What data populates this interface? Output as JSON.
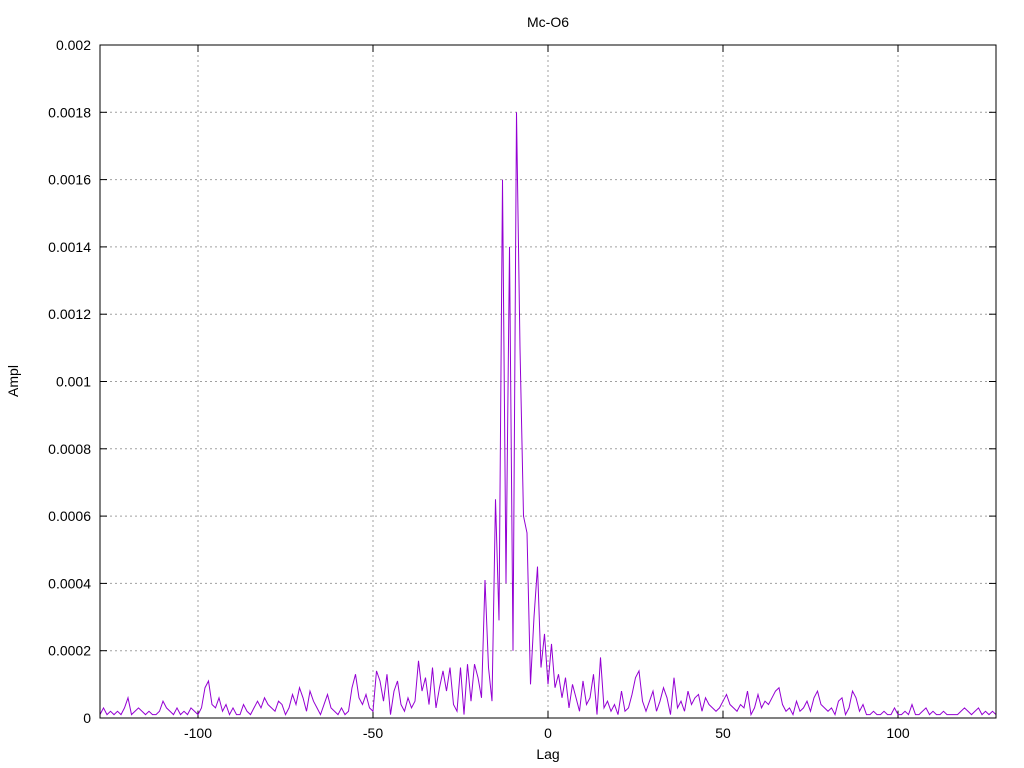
{
  "chart_data": {
    "type": "line",
    "title": "Mc-O6",
    "xlabel": "Lag",
    "ylabel": "Ampl",
    "xlim": [
      -128,
      128
    ],
    "ylim": [
      0,
      0.002
    ],
    "x_ticks": [
      -100,
      -50,
      0,
      50,
      100
    ],
    "x_tick_labels": [
      "-100",
      "-50",
      "0",
      "50",
      "100"
    ],
    "y_ticks": [
      0,
      0.0002,
      0.0004,
      0.0006,
      0.0008,
      0.001,
      0.0012,
      0.0014,
      0.0016,
      0.0018,
      0.002
    ],
    "y_tick_labels": [
      "0",
      "0.0002",
      "0.0004",
      "0.0006",
      "0.0008",
      "0.001",
      "0.0012",
      "0.0014",
      "0.0016",
      "0.0018",
      "0.002"
    ],
    "grid": true,
    "line_color": "#9400D3",
    "series": [
      {
        "x": [
          -128,
          -127,
          -126,
          -125,
          -124,
          -123,
          -122,
          -121,
          -120,
          -119,
          -118,
          -117,
          -116,
          -115,
          -114,
          -113,
          -112,
          -111,
          -110,
          -109,
          -108,
          -107,
          -106,
          -105,
          -104,
          -103,
          -102,
          -101,
          -100,
          -99,
          -98,
          -97,
          -96,
          -95,
          -94,
          -93,
          -92,
          -91,
          -90,
          -89,
          -88,
          -87,
          -86,
          -85,
          -84,
          -83,
          -82,
          -81,
          -80,
          -79,
          -78,
          -77,
          -76,
          -75,
          -74,
          -73,
          -72,
          -71,
          -70,
          -69,
          -68,
          -67,
          -66,
          -65,
          -64,
          -63,
          -62,
          -61,
          -60,
          -59,
          -58,
          -57,
          -56,
          -55,
          -54,
          -53,
          -52,
          -51,
          -50,
          -49,
          -48,
          -47,
          -46,
          -45,
          -44,
          -43,
          -42,
          -41,
          -40,
          -39,
          -38,
          -37,
          -36,
          -35,
          -34,
          -33,
          -32,
          -31,
          -30,
          -29,
          -28,
          -27,
          -26,
          -25,
          -24,
          -23,
          -22,
          -21,
          -20,
          -19,
          -18,
          -17,
          -16,
          -15,
          -14,
          -13,
          -12,
          -11,
          -10,
          -9,
          -8,
          -7,
          -6,
          -5,
          -4,
          -3,
          -2,
          -1,
          0,
          1,
          2,
          3,
          4,
          5,
          6,
          7,
          8,
          9,
          10,
          11,
          12,
          13,
          14,
          15,
          16,
          17,
          18,
          19,
          20,
          21,
          22,
          23,
          24,
          25,
          26,
          27,
          28,
          29,
          30,
          31,
          32,
          33,
          34,
          35,
          36,
          37,
          38,
          39,
          40,
          41,
          42,
          43,
          44,
          45,
          46,
          47,
          48,
          49,
          50,
          51,
          52,
          53,
          54,
          55,
          56,
          57,
          58,
          59,
          60,
          61,
          62,
          63,
          64,
          65,
          66,
          67,
          68,
          69,
          70,
          71,
          72,
          73,
          74,
          75,
          76,
          77,
          78,
          79,
          80,
          81,
          82,
          83,
          84,
          85,
          86,
          87,
          88,
          89,
          90,
          91,
          92,
          93,
          94,
          95,
          96,
          97,
          98,
          99,
          100,
          101,
          102,
          103,
          104,
          105,
          106,
          107,
          108,
          109,
          110,
          111,
          112,
          113,
          114,
          115,
          116,
          117,
          118,
          119,
          120,
          121,
          122,
          123,
          124,
          125,
          126,
          127,
          128
        ],
        "y": [
          1e-05,
          3e-05,
          1e-05,
          2e-05,
          1e-05,
          2e-05,
          1e-05,
          3e-05,
          6e-05,
          1e-05,
          2e-05,
          3e-05,
          2e-05,
          1e-05,
          2e-05,
          1e-05,
          1e-05,
          2e-05,
          5e-05,
          3e-05,
          2e-05,
          1e-05,
          3e-05,
          1e-05,
          2e-05,
          1e-05,
          3e-05,
          2e-05,
          1e-05,
          3e-05,
          9e-05,
          0.00011,
          4e-05,
          3e-05,
          6e-05,
          2e-05,
          4e-05,
          1e-05,
          3e-05,
          1e-05,
          1e-05,
          4e-05,
          2e-05,
          1e-05,
          3e-05,
          5e-05,
          3e-05,
          6e-05,
          4e-05,
          3e-05,
          2e-05,
          5e-05,
          4e-05,
          1e-05,
          3e-05,
          7e-05,
          4e-05,
          9e-05,
          6e-05,
          2e-05,
          8e-05,
          5e-05,
          3e-05,
          1e-05,
          4e-05,
          7e-05,
          3e-05,
          2e-05,
          1e-05,
          3e-05,
          1e-05,
          2e-05,
          9e-05,
          0.00013,
          6e-05,
          4e-05,
          7e-05,
          3e-05,
          2e-05,
          0.00014,
          0.00011,
          5e-05,
          0.00013,
          1e-05,
          8e-05,
          0.00011,
          4e-05,
          2e-05,
          6e-05,
          3e-05,
          5e-05,
          0.00017,
          8e-05,
          0.00012,
          4e-05,
          0.00015,
          3e-05,
          9e-05,
          0.00014,
          8e-05,
          0.00015,
          4e-05,
          2e-05,
          0.00015,
          1e-05,
          0.00016,
          5e-05,
          0.00016,
          0.00012,
          6e-05,
          0.00041,
          0.00015,
          5e-05,
          0.00065,
          0.00029,
          0.0016,
          0.0004,
          0.0014,
          0.0002,
          0.0018,
          0.0011,
          0.0006,
          0.00055,
          0.0001,
          0.0003,
          0.00045,
          0.00015,
          0.00025,
          0.0001,
          0.00022,
          9e-05,
          0.00013,
          6e-05,
          0.00012,
          3e-05,
          0.0001,
          6e-05,
          2e-05,
          0.00011,
          4e-05,
          6e-05,
          0.00013,
          1e-05,
          0.00018,
          3e-05,
          5e-05,
          2e-05,
          4e-05,
          1e-05,
          8e-05,
          2e-05,
          3e-05,
          7e-05,
          0.00012,
          0.00014,
          5e-05,
          2e-05,
          5e-05,
          8e-05,
          2e-05,
          5e-05,
          9e-05,
          6e-05,
          1e-05,
          0.00012,
          3e-05,
          5e-05,
          2e-05,
          8e-05,
          4e-05,
          6e-05,
          7e-05,
          2e-05,
          6e-05,
          4e-05,
          3e-05,
          2e-05,
          3e-05,
          5e-05,
          7e-05,
          4e-05,
          3e-05,
          2e-05,
          4e-05,
          3e-05,
          8e-05,
          1e-05,
          3e-05,
          7e-05,
          3e-05,
          5e-05,
          4e-05,
          6e-05,
          8e-05,
          9e-05,
          4e-05,
          2e-05,
          3e-05,
          1e-05,
          5e-05,
          2e-05,
          3e-05,
          5e-05,
          2e-05,
          6e-05,
          8e-05,
          4e-05,
          3e-05,
          2e-05,
          3e-05,
          1e-05,
          5e-05,
          6e-05,
          1e-05,
          3e-05,
          8e-05,
          6e-05,
          2e-05,
          4e-05,
          1e-05,
          1e-05,
          2e-05,
          1e-05,
          1e-05,
          2e-05,
          1e-05,
          1e-05,
          3e-05,
          1e-05,
          1e-05,
          2e-05,
          1e-05,
          4e-05,
          1e-05,
          1e-05,
          2e-05,
          3e-05,
          1e-05,
          2e-05,
          1e-05,
          1e-05,
          2e-05,
          1e-05,
          1e-05,
          1e-05,
          1e-05,
          2e-05,
          3e-05,
          2e-05,
          1e-05,
          2e-05,
          3e-05,
          1e-05,
          2e-05,
          1e-05,
          2e-05,
          1e-05
        ]
      }
    ]
  }
}
